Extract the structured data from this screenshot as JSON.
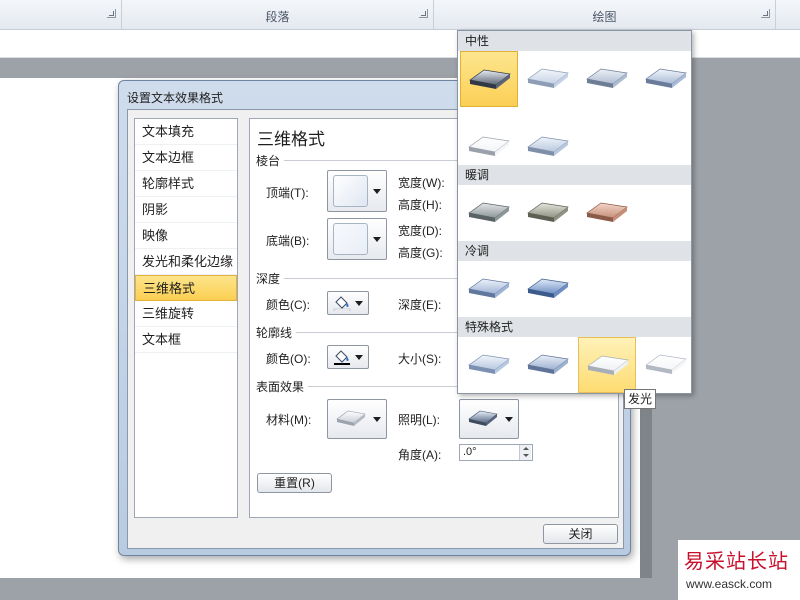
{
  "ribbon": {
    "groups": [
      {
        "label": "",
        "key": "font"
      },
      {
        "label": "段落",
        "key": "paragraph"
      },
      {
        "label": "绘图",
        "key": "drawing"
      }
    ]
  },
  "dialog": {
    "title": "设置文本效果格式",
    "nav": [
      "文本填充",
      "文本边框",
      "轮廓样式",
      "阴影",
      "映像",
      "发光和柔化边缘",
      "三维格式",
      "三维旋转",
      "文本框"
    ],
    "selected_nav": "三维格式",
    "panel": {
      "title": "三维格式",
      "bevel": {
        "heading": "棱台",
        "top_label": "顶端(T):",
        "bottom_label": "底端(B):",
        "width1": "宽度(W):",
        "height1": "高度(H):",
        "width2": "宽度(D):",
        "height2": "高度(G):"
      },
      "depth": {
        "heading": "深度",
        "color_label": "颜色(C):",
        "depth_label": "深度(E):"
      },
      "contour": {
        "heading": "轮廓线",
        "color_label": "颜色(O):",
        "size_label": "大小(S):"
      },
      "surface": {
        "heading": "表面效果",
        "material_label": "材料(M):",
        "lighting_label": "照明(L):",
        "angle_label": "角度(A):",
        "angle_value": ".0°"
      },
      "reset_button": "重置(R)"
    },
    "close_button": "关闭"
  },
  "gallery": {
    "sections": [
      {
        "heading": "中性",
        "count": 6
      },
      {
        "heading": "暖调",
        "count": 3
      },
      {
        "heading": "冷调",
        "count": 2
      },
      {
        "heading": "特殊格式",
        "count": 4
      }
    ],
    "selected": "中性-1",
    "hovered": "特殊格式-3",
    "tooltip": "发光"
  },
  "watermark": {
    "brand": "易采站长站",
    "url": "www.easck.com"
  },
  "colors": {
    "selection": "#fbcf52",
    "dialog_frame": "#b9cbe1",
    "gallery_header": "#dfe2e6",
    "watermark_red": "#c8102e"
  }
}
